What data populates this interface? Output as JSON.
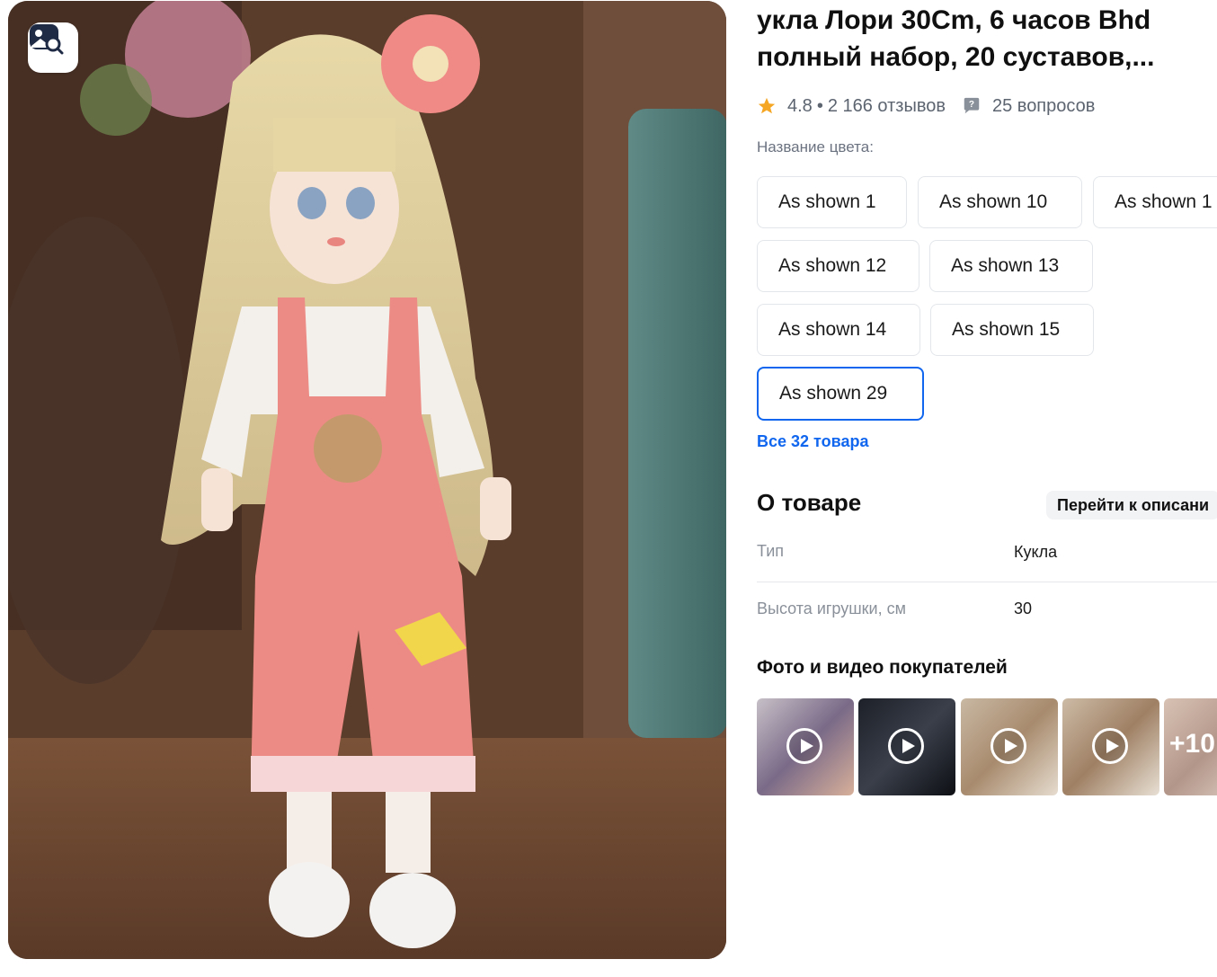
{
  "product": {
    "title_line1": "укла Лори 30Cm, 6 часов Bhd",
    "title_line2": "полный набор, 20 суставов,...",
    "rating": "4.8",
    "reviews": "2 166 отзывов",
    "questions": "25 вопросов"
  },
  "colors": {
    "label": "Название цвета:",
    "options": [
      "As shown 1",
      "As shown 10",
      "As shown 1",
      "As shown 12",
      "As shown 13",
      "As shown 14",
      "As shown 15",
      "As shown 29"
    ],
    "selected": "As shown 29",
    "all_link": "Все 32 товара"
  },
  "about": {
    "title": "О товаре",
    "goto_button": "Перейти к описани",
    "specs": [
      {
        "key": "Тип",
        "value": "Кукла"
      },
      {
        "key": "Высота игрушки, см",
        "value": "30"
      }
    ]
  },
  "buyer_media": {
    "title": "Фото и видео покупателей",
    "more_count": "+10"
  },
  "icons": {
    "image_search": "image-search-icon",
    "star": "star-icon",
    "question": "question-bubble-icon",
    "play": "play-icon"
  },
  "colors_theme": {
    "accent": "#1066ee",
    "star": "#f5a623"
  }
}
